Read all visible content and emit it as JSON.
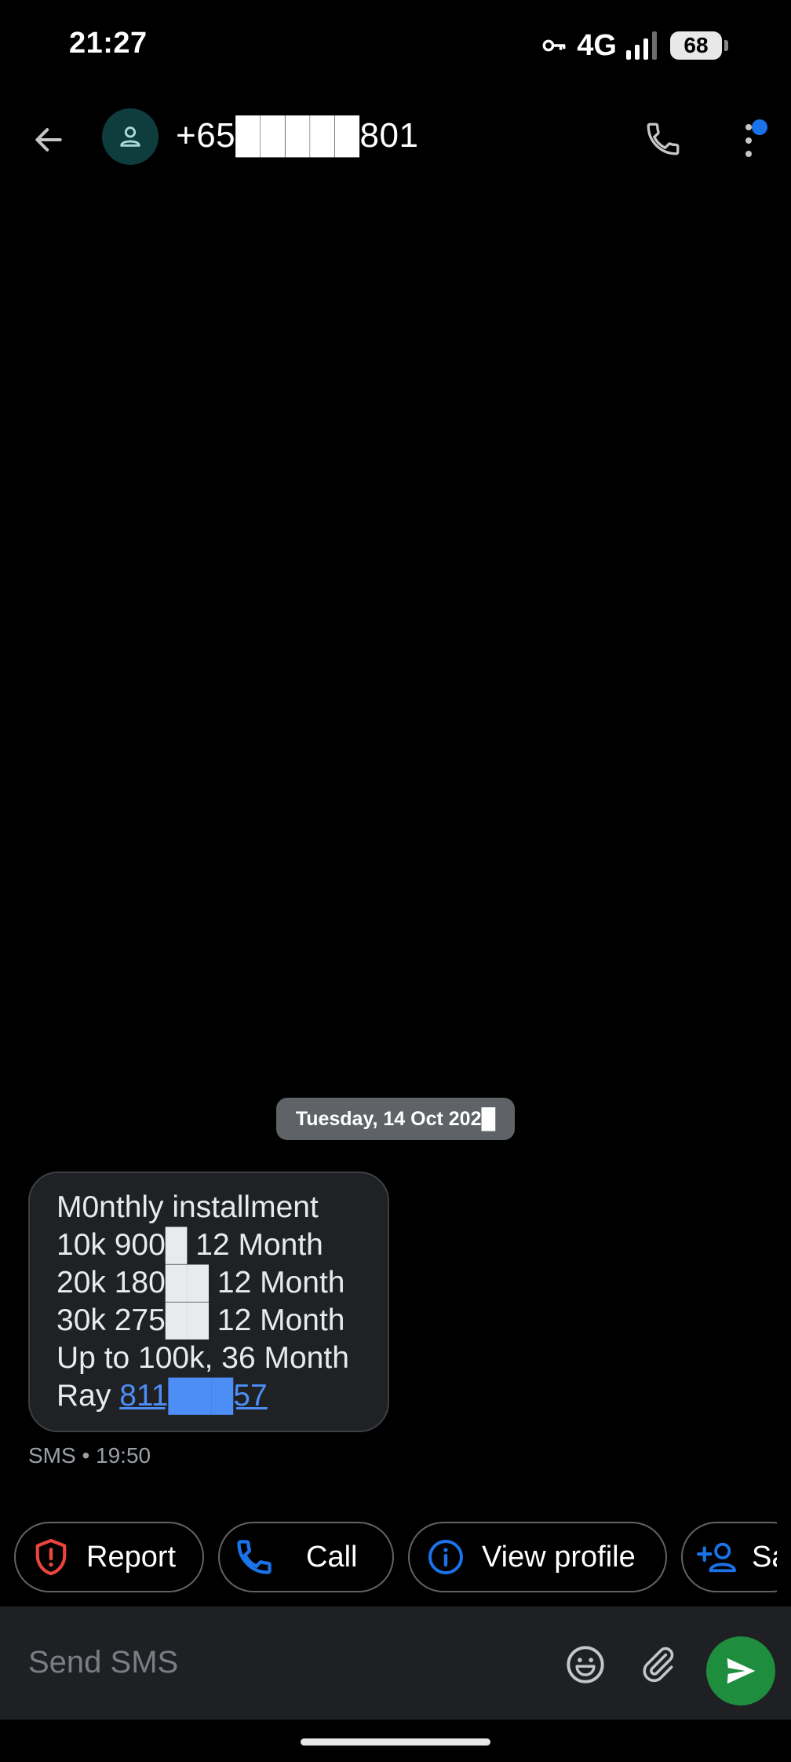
{
  "status_bar": {
    "time": "21:27",
    "network": "4G",
    "battery": "68"
  },
  "header": {
    "contact_number": "+65█████801"
  },
  "conversation": {
    "date_chip": "Tuesday, 14 Oct 202█",
    "message": {
      "lines": [
        "M0nthly installment",
        "10k 900█ 12 Month",
        "20k 180██ 12 Month",
        "30k 275██ 12 Month",
        "Up to 100k, 36 Month"
      ],
      "sender_prefix": "Ray ",
      "phone_link": "811███57",
      "meta": "SMS • 19:50"
    }
  },
  "suggestions": [
    {
      "label": "Report",
      "icon": "shield-alert-icon",
      "color": "#e8453c"
    },
    {
      "label": "Call",
      "icon": "phone-icon",
      "color": "#1a73e8"
    },
    {
      "label": "View profile",
      "icon": "info-icon",
      "color": "#1a73e8"
    },
    {
      "label": "Sa",
      "icon": "add-person-icon",
      "color": "#1a73e8"
    }
  ],
  "composer": {
    "placeholder": "Send SMS"
  },
  "colors": {
    "accent_blue": "#1a73e8",
    "send_green": "#1e8e3e",
    "report_red": "#e8453c"
  }
}
